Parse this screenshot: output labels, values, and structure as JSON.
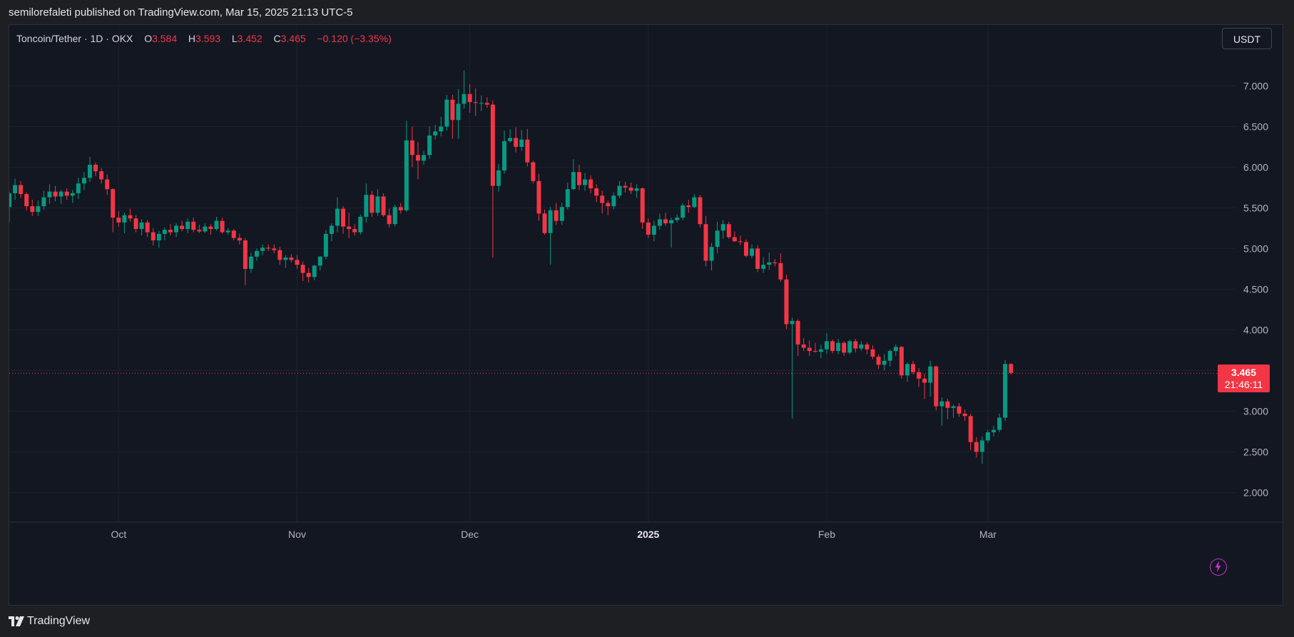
{
  "header": {
    "published_text": "semilorefaleti published on TradingView.com, Mar 15, 2025 21:13 UTC-5"
  },
  "legend": {
    "symbol": "Toncoin/Tether · 1D · OKX",
    "open_label": "O",
    "open": "3.584",
    "high_label": "H",
    "high": "3.593",
    "low_label": "L",
    "low": "3.452",
    "close_label": "C",
    "close": "3.465",
    "change": "−0.120 (−3.35%)"
  },
  "currency_button": "USDT",
  "price_tag": {
    "price": "3.465",
    "countdown": "21:46:11"
  },
  "footer": {
    "brand": "TradingView"
  },
  "icons": {
    "bolt": "lightning-icon",
    "logo": "tradingview-logo-icon"
  },
  "colors": {
    "up": "#089981",
    "down": "#f23645",
    "background": "#131722",
    "grid": "#1e222d",
    "text": "#b2b5be"
  },
  "chart_data": {
    "type": "candlestick",
    "symbol": "Toncoin/Tether",
    "interval": "1D",
    "exchange": "OKX",
    "ylim": [
      1.9,
      7.5
    ],
    "y_ticks": [
      2.0,
      2.5,
      3.0,
      3.5,
      4.0,
      4.5,
      5.0,
      5.5,
      6.0,
      6.5,
      7.0
    ],
    "y_tick_labels": [
      "2.000",
      "2.500",
      "3.000",
      "3.500",
      "4.000",
      "4.500",
      "5.000",
      "5.500",
      "6.000",
      "6.500",
      "7.000"
    ],
    "x_labels": [
      {
        "label": "Oct",
        "date": "2024-10-01",
        "bold": false
      },
      {
        "label": "Nov",
        "date": "2024-11-01",
        "bold": false
      },
      {
        "label": "Dec",
        "date": "2024-12-01",
        "bold": false
      },
      {
        "label": "2025",
        "date": "2025-01-01",
        "bold": true
      },
      {
        "label": "Feb",
        "date": "2025-02-01",
        "bold": false
      },
      {
        "label": "Mar",
        "date": "2025-03-01",
        "bold": false
      }
    ],
    "last_price": 3.465,
    "grid": true,
    "first_date": "2024-09-12",
    "candles": [
      [
        5.51,
        5.7,
        5.32,
        5.68
      ],
      [
        5.68,
        5.86,
        5.6,
        5.78
      ],
      [
        5.78,
        5.83,
        5.62,
        5.67
      ],
      [
        5.67,
        5.69,
        5.47,
        5.52
      ],
      [
        5.52,
        5.6,
        5.4,
        5.45
      ],
      [
        5.45,
        5.59,
        5.4,
        5.52
      ],
      [
        5.52,
        5.71,
        5.48,
        5.63
      ],
      [
        5.63,
        5.79,
        5.55,
        5.7
      ],
      [
        5.7,
        5.77,
        5.58,
        5.64
      ],
      [
        5.64,
        5.72,
        5.55,
        5.7
      ],
      [
        5.7,
        5.74,
        5.6,
        5.65
      ],
      [
        5.65,
        5.72,
        5.56,
        5.68
      ],
      [
        5.68,
        5.87,
        5.61,
        5.8
      ],
      [
        5.8,
        5.94,
        5.72,
        5.87
      ],
      [
        5.87,
        6.13,
        5.82,
        6.03
      ],
      [
        6.03,
        6.06,
        5.89,
        5.95
      ],
      [
        5.95,
        5.99,
        5.8,
        5.85
      ],
      [
        5.85,
        5.91,
        5.66,
        5.73
      ],
      [
        5.73,
        5.74,
        5.2,
        5.38
      ],
      [
        5.38,
        5.46,
        5.27,
        5.32
      ],
      [
        5.32,
        5.44,
        5.19,
        5.41
      ],
      [
        5.41,
        5.49,
        5.33,
        5.37
      ],
      [
        5.37,
        5.41,
        5.2,
        5.24
      ],
      [
        5.24,
        5.36,
        5.16,
        5.32
      ],
      [
        5.32,
        5.35,
        5.14,
        5.2
      ],
      [
        5.2,
        5.25,
        5.04,
        5.1
      ],
      [
        5.1,
        5.22,
        5.01,
        5.18
      ],
      [
        5.18,
        5.26,
        5.1,
        5.23
      ],
      [
        5.23,
        5.3,
        5.16,
        5.2
      ],
      [
        5.2,
        5.31,
        5.14,
        5.28
      ],
      [
        5.28,
        5.34,
        5.21,
        5.24
      ],
      [
        5.24,
        5.37,
        5.19,
        5.33
      ],
      [
        5.33,
        5.38,
        5.2,
        5.23
      ],
      [
        5.23,
        5.29,
        5.19,
        5.21
      ],
      [
        5.21,
        5.31,
        5.19,
        5.27
      ],
      [
        5.27,
        5.3,
        5.17,
        5.24
      ],
      [
        5.24,
        5.39,
        5.22,
        5.34
      ],
      [
        5.34,
        5.38,
        5.18,
        5.2
      ],
      [
        5.2,
        5.25,
        5.17,
        5.22
      ],
      [
        5.22,
        5.24,
        5.1,
        5.13
      ],
      [
        5.13,
        5.18,
        5.05,
        5.1
      ],
      [
        5.1,
        5.13,
        4.55,
        4.75
      ],
      [
        4.75,
        4.95,
        4.7,
        4.9
      ],
      [
        4.9,
        5.0,
        4.85,
        4.97
      ],
      [
        4.97,
        5.05,
        4.92,
        5.01
      ],
      [
        5.01,
        5.05,
        4.97,
        5.0
      ],
      [
        5.0,
        5.05,
        4.94,
        4.98
      ],
      [
        4.98,
        5.02,
        4.8,
        4.86
      ],
      [
        4.86,
        4.92,
        4.76,
        4.89
      ],
      [
        4.89,
        4.93,
        4.83,
        4.86
      ],
      [
        4.86,
        4.92,
        4.75,
        4.8
      ],
      [
        4.8,
        4.84,
        4.6,
        4.7
      ],
      [
        4.7,
        4.76,
        4.58,
        4.65
      ],
      [
        4.65,
        4.8,
        4.61,
        4.79
      ],
      [
        4.79,
        4.91,
        4.73,
        4.9
      ],
      [
        4.9,
        5.23,
        4.87,
        5.18
      ],
      [
        5.18,
        5.31,
        5.09,
        5.28
      ],
      [
        5.28,
        5.63,
        5.2,
        5.49
      ],
      [
        5.49,
        5.52,
        5.18,
        5.27
      ],
      [
        5.27,
        5.44,
        5.13,
        5.24
      ],
      [
        5.24,
        5.3,
        5.16,
        5.2
      ],
      [
        5.2,
        5.42,
        5.17,
        5.39
      ],
      [
        5.39,
        5.8,
        5.32,
        5.66
      ],
      [
        5.66,
        5.71,
        5.39,
        5.44
      ],
      [
        5.44,
        5.73,
        5.4,
        5.64
      ],
      [
        5.64,
        5.68,
        5.39,
        5.41
      ],
      [
        5.41,
        5.49,
        5.26,
        5.3
      ],
      [
        5.3,
        5.54,
        5.27,
        5.51
      ],
      [
        5.51,
        5.56,
        5.43,
        5.47
      ],
      [
        5.47,
        6.57,
        5.45,
        6.33
      ],
      [
        6.33,
        6.5,
        6.0,
        6.15
      ],
      [
        6.15,
        6.31,
        5.85,
        6.08
      ],
      [
        6.08,
        6.2,
        6.03,
        6.15
      ],
      [
        6.15,
        6.5,
        6.1,
        6.39
      ],
      [
        6.39,
        6.52,
        6.34,
        6.44
      ],
      [
        6.44,
        6.62,
        6.38,
        6.5
      ],
      [
        6.5,
        6.89,
        6.45,
        6.83
      ],
      [
        6.83,
        6.89,
        6.35,
        6.58
      ],
      [
        6.58,
        6.96,
        6.35,
        6.78
      ],
      [
        6.78,
        7.19,
        6.72,
        6.9
      ],
      [
        6.9,
        7.02,
        6.67,
        6.8
      ],
      [
        6.8,
        6.97,
        6.63,
        6.79
      ],
      [
        6.79,
        6.88,
        6.69,
        6.79
      ],
      [
        6.79,
        6.86,
        6.73,
        6.77
      ],
      [
        6.77,
        6.82,
        4.89,
        5.77
      ],
      [
        5.77,
        6.04,
        5.7,
        5.96
      ],
      [
        5.96,
        6.45,
        5.92,
        6.32
      ],
      [
        6.32,
        6.47,
        6.3,
        6.36
      ],
      [
        6.36,
        6.49,
        6.18,
        6.25
      ],
      [
        6.25,
        6.46,
        6.2,
        6.34
      ],
      [
        6.34,
        6.47,
        6.01,
        6.06
      ],
      [
        6.06,
        6.08,
        5.8,
        5.83
      ],
      [
        5.83,
        5.92,
        5.34,
        5.43
      ],
      [
        5.43,
        5.48,
        5.17,
        5.19
      ],
      [
        5.19,
        5.51,
        4.8,
        5.47
      ],
      [
        5.47,
        5.56,
        5.29,
        5.34
      ],
      [
        5.34,
        5.56,
        5.29,
        5.51
      ],
      [
        5.51,
        5.81,
        5.48,
        5.73
      ],
      [
        5.73,
        6.1,
        5.72,
        5.94
      ],
      [
        5.94,
        6.03,
        5.72,
        5.78
      ],
      [
        5.78,
        5.93,
        5.71,
        5.85
      ],
      [
        5.85,
        5.9,
        5.68,
        5.74
      ],
      [
        5.74,
        5.79,
        5.57,
        5.65
      ],
      [
        5.65,
        5.71,
        5.43,
        5.56
      ],
      [
        5.56,
        5.59,
        5.41,
        5.52
      ],
      [
        5.52,
        5.69,
        5.48,
        5.65
      ],
      [
        5.65,
        5.83,
        5.62,
        5.77
      ],
      [
        5.77,
        5.82,
        5.69,
        5.75
      ],
      [
        5.75,
        5.81,
        5.67,
        5.71
      ],
      [
        5.71,
        5.79,
        5.62,
        5.74
      ],
      [
        5.74,
        5.75,
        5.24,
        5.32
      ],
      [
        5.32,
        5.37,
        5.13,
        5.17
      ],
      [
        5.17,
        5.34,
        5.09,
        5.28
      ],
      [
        5.28,
        5.43,
        5.23,
        5.36
      ],
      [
        5.36,
        5.44,
        5.28,
        5.31
      ],
      [
        5.31,
        5.38,
        5.01,
        5.35
      ],
      [
        5.35,
        5.42,
        5.32,
        5.38
      ],
      [
        5.38,
        5.56,
        5.35,
        5.53
      ],
      [
        5.53,
        5.6,
        5.44,
        5.51
      ],
      [
        5.51,
        5.67,
        5.5,
        5.63
      ],
      [
        5.63,
        5.66,
        5.26,
        5.3
      ],
      [
        5.3,
        5.4,
        4.78,
        4.85
      ],
      [
        4.85,
        5.07,
        4.73,
        5.02
      ],
      [
        5.02,
        5.33,
        4.94,
        5.22
      ],
      [
        5.22,
        5.35,
        5.12,
        5.3
      ],
      [
        5.3,
        5.33,
        5.12,
        5.14
      ],
      [
        5.14,
        5.21,
        5.08,
        5.09
      ],
      [
        5.09,
        5.16,
        5.04,
        5.08
      ],
      [
        5.08,
        5.11,
        4.89,
        4.91
      ],
      [
        4.91,
        5.05,
        4.88,
        5.0
      ],
      [
        5.0,
        5.04,
        4.71,
        4.75
      ],
      [
        4.75,
        4.89,
        4.7,
        4.8
      ],
      [
        4.8,
        4.95,
        4.74,
        4.83
      ],
      [
        4.83,
        4.87,
        4.78,
        4.82
      ],
      [
        4.82,
        4.94,
        4.59,
        4.62
      ],
      [
        4.62,
        4.68,
        4.01,
        4.07
      ],
      [
        4.07,
        4.15,
        2.91,
        4.11
      ],
      [
        4.11,
        4.13,
        3.68,
        3.82
      ],
      [
        3.82,
        3.9,
        3.74,
        3.78
      ],
      [
        3.78,
        3.87,
        3.68,
        3.74
      ],
      [
        3.74,
        3.84,
        3.72,
        3.73
      ],
      [
        3.73,
        3.82,
        3.65,
        3.76
      ],
      [
        3.76,
        3.96,
        3.7,
        3.86
      ],
      [
        3.86,
        3.88,
        3.71,
        3.74
      ],
      [
        3.74,
        3.89,
        3.7,
        3.84
      ],
      [
        3.84,
        3.86,
        3.68,
        3.72
      ],
      [
        3.72,
        3.88,
        3.7,
        3.86
      ],
      [
        3.86,
        3.89,
        3.72,
        3.77
      ],
      [
        3.77,
        3.86,
        3.74,
        3.82
      ],
      [
        3.82,
        3.85,
        3.7,
        3.76
      ],
      [
        3.76,
        3.81,
        3.64,
        3.67
      ],
      [
        3.67,
        3.7,
        3.52,
        3.57
      ],
      [
        3.57,
        3.7,
        3.5,
        3.62
      ],
      [
        3.62,
        3.76,
        3.55,
        3.74
      ],
      [
        3.74,
        3.82,
        3.68,
        3.79
      ],
      [
        3.79,
        3.8,
        3.4,
        3.44
      ],
      [
        3.44,
        3.6,
        3.36,
        3.58
      ],
      [
        3.58,
        3.62,
        3.45,
        3.48
      ],
      [
        3.48,
        3.53,
        3.3,
        3.4
      ],
      [
        3.4,
        3.46,
        3.15,
        3.35
      ],
      [
        3.35,
        3.62,
        3.18,
        3.55
      ],
      [
        3.55,
        3.56,
        3.01,
        3.06
      ],
      [
        3.06,
        3.17,
        2.82,
        3.12
      ],
      [
        3.12,
        3.15,
        2.9,
        3.04
      ],
      [
        3.04,
        3.08,
        2.92,
        3.06
      ],
      [
        3.06,
        3.1,
        2.93,
        2.97
      ],
      [
        2.97,
        3.02,
        2.88,
        2.94
      ],
      [
        2.94,
        2.97,
        2.52,
        2.62
      ],
      [
        2.62,
        2.68,
        2.43,
        2.5
      ],
      [
        2.5,
        2.69,
        2.35,
        2.64
      ],
      [
        2.64,
        2.77,
        2.61,
        2.74
      ],
      [
        2.74,
        2.82,
        2.69,
        2.77
      ],
      [
        2.77,
        2.97,
        2.74,
        2.92
      ],
      [
        2.92,
        3.63,
        2.88,
        3.58
      ],
      [
        3.58,
        3.59,
        3.45,
        3.47
      ]
    ]
  }
}
